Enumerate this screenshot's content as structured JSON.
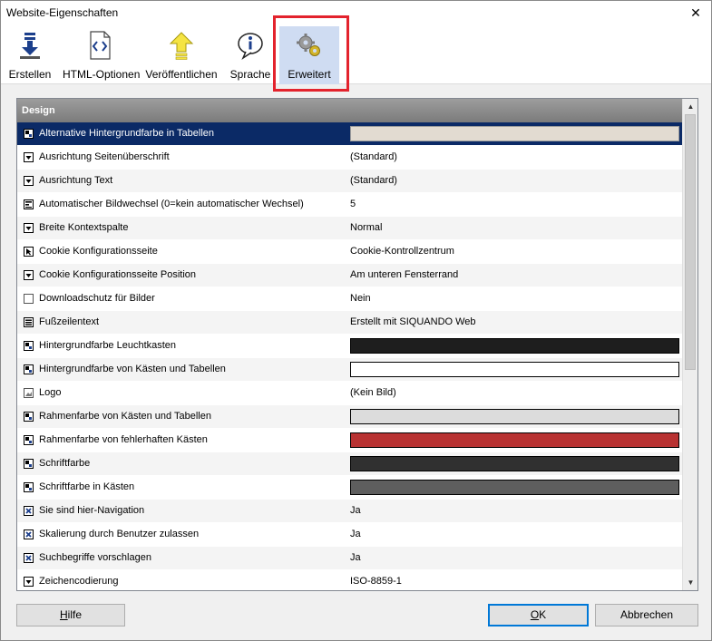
{
  "window": {
    "title": "Website-Eigenschaften",
    "close_symbol": "✕"
  },
  "toolbar": {
    "buttons": [
      {
        "label": "Erstellen"
      },
      {
        "label": "HTML-Optionen"
      },
      {
        "label": "Veröffentlichen"
      },
      {
        "label": "Sprache"
      },
      {
        "label": "Erweitert",
        "active": true
      }
    ]
  },
  "grid": {
    "category": "Design",
    "rows": [
      {
        "name": "Alternative Hintergrundfarbe in Tabellen",
        "type": "color",
        "value": "#e2dbd1",
        "icon": "color-icon",
        "selected": true
      },
      {
        "name": "Ausrichtung Seitenüberschrift",
        "type": "dropdown",
        "value": "(Standard)",
        "icon": "dropdown-icon"
      },
      {
        "name": "Ausrichtung Text",
        "type": "dropdown",
        "value": "(Standard)",
        "icon": "dropdown-icon"
      },
      {
        "name": "Automatischer Bildwechsel (0=kein automatischer Wechsel)",
        "type": "number",
        "value": "5",
        "icon": "number-icon"
      },
      {
        "name": "Breite Kontextspalte",
        "type": "dropdown",
        "value": "Normal",
        "icon": "dropdown-icon"
      },
      {
        "name": "Cookie Konfigurationsseite",
        "type": "link",
        "value": "Cookie-Kontrollzentrum",
        "icon": "pointer-icon"
      },
      {
        "name": "Cookie Konfigurationsseite Position",
        "type": "dropdown",
        "value": "Am unteren Fensterrand",
        "icon": "dropdown-icon"
      },
      {
        "name": "Downloadschutz für Bilder",
        "type": "checkbox",
        "value": "Nein",
        "icon": "checkbox-empty-icon"
      },
      {
        "name": "Fußzeilentext",
        "type": "text",
        "value": "Erstellt mit SIQUANDO Web",
        "icon": "text-lines-icon"
      },
      {
        "name": "Hintergrundfarbe Leuchtkasten",
        "type": "color",
        "value": "#1e1e1e",
        "icon": "color-icon"
      },
      {
        "name": "Hintergrundfarbe von Kästen und Tabellen",
        "type": "color",
        "value": "#ffffff",
        "icon": "color-icon"
      },
      {
        "name": "Logo",
        "type": "image",
        "value": "(Kein Bild)",
        "icon": "image-icon"
      },
      {
        "name": "Rahmenfarbe von Kästen und Tabellen",
        "type": "color",
        "value": "#dcdcdc",
        "icon": "color-icon"
      },
      {
        "name": "Rahmenfarbe von fehlerhaften Kästen",
        "type": "color",
        "value": "#b83232",
        "icon": "color-icon"
      },
      {
        "name": "Schriftfarbe",
        "type": "color",
        "value": "#303030",
        "icon": "color-icon"
      },
      {
        "name": "Schriftfarbe in Kästen",
        "type": "color",
        "value": "#5e5e5e",
        "icon": "color-icon"
      },
      {
        "name": "Sie sind hier-Navigation",
        "type": "checkbox",
        "value": "Ja",
        "icon": "checkbox-checked-icon"
      },
      {
        "name": "Skalierung durch Benutzer zulassen",
        "type": "checkbox",
        "value": "Ja",
        "icon": "checkbox-checked-icon"
      },
      {
        "name": "Suchbegriffe vorschlagen",
        "type": "checkbox",
        "value": "Ja",
        "icon": "checkbox-checked-icon"
      },
      {
        "name": "Zeichencodierung",
        "type": "dropdown",
        "value": "ISO-8859-1",
        "icon": "dropdown-icon"
      }
    ]
  },
  "footer": {
    "help": {
      "first": "H",
      "rest": "ilfe"
    },
    "ok": {
      "first": "O",
      "rest": "K"
    },
    "cancel": {
      "label": "Abbrechen"
    }
  },
  "colors": {
    "selection": "#0b2a66",
    "highlight_frame": "#e3232d",
    "active_tab": "#cfdcf2"
  }
}
